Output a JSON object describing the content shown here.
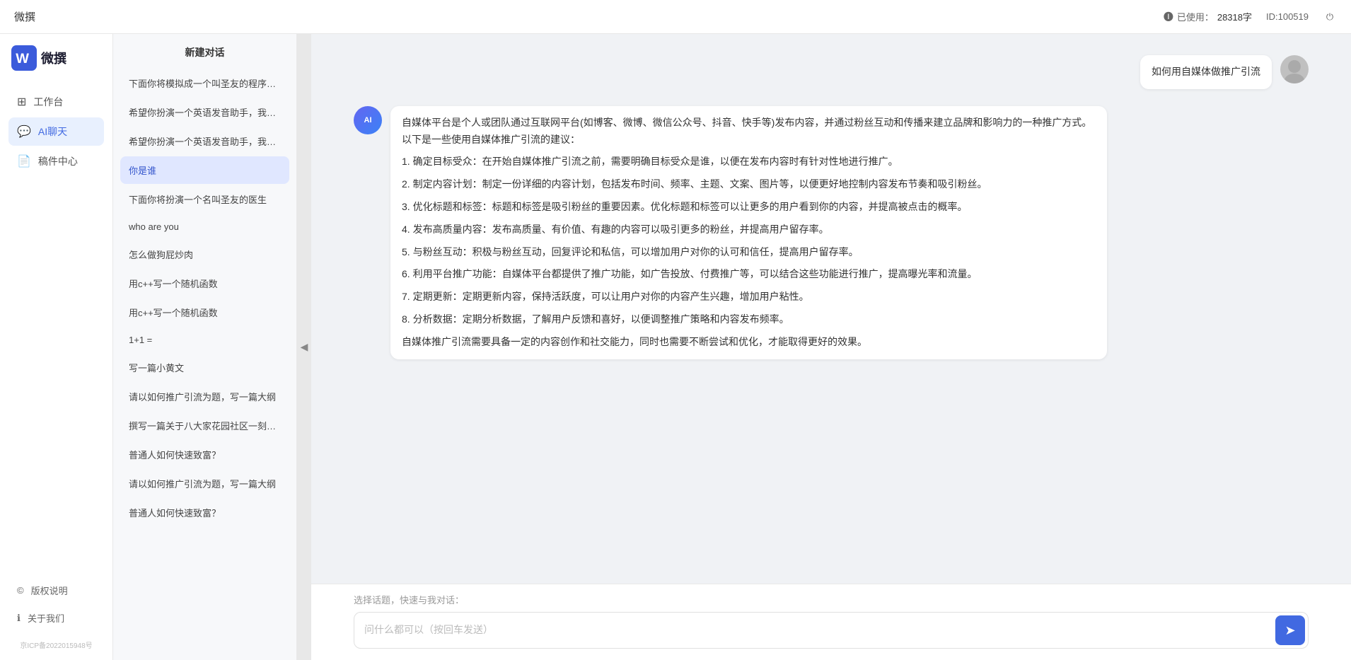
{
  "topbar": {
    "title": "微撰",
    "usage_label": "已使用：",
    "usage_value": "28318字",
    "id_label": "ID:100519",
    "power_icon": "⏻"
  },
  "sidebar": {
    "logo_text": "微撰",
    "nav_items": [
      {
        "id": "workbench",
        "label": "工作台",
        "icon": "⊞"
      },
      {
        "id": "ai-chat",
        "label": "AI聊天",
        "icon": "💬",
        "active": true
      },
      {
        "id": "drafts",
        "label": "稿件中心",
        "icon": "📄"
      }
    ],
    "bottom_items": [
      {
        "id": "copyright",
        "label": "版权说明",
        "icon": "©"
      },
      {
        "id": "about",
        "label": "关于我们",
        "icon": "ℹ"
      }
    ],
    "icp": "京ICP备2022015948号"
  },
  "chat_history": {
    "new_chat_label": "新建对话",
    "items": [
      {
        "id": "h1",
        "text": "下面你将模拟成一个叫圣友的程序员，我说...",
        "active": false
      },
      {
        "id": "h2",
        "text": "希望你扮演一个英语发音助手，我提供给你...",
        "active": false
      },
      {
        "id": "h3",
        "text": "希望你扮演一个英语发音助手，我提供给你...",
        "active": false
      },
      {
        "id": "h4",
        "text": "你是谁",
        "active": true
      },
      {
        "id": "h5",
        "text": "下面你将扮演一个名叫圣友的医生",
        "active": false
      },
      {
        "id": "h6",
        "text": "who are you",
        "active": false
      },
      {
        "id": "h7",
        "text": "怎么做狗屁炒肉",
        "active": false
      },
      {
        "id": "h8",
        "text": "用c++写一个随机函数",
        "active": false
      },
      {
        "id": "h9",
        "text": "用c++写一个随机函数",
        "active": false
      },
      {
        "id": "h10",
        "text": "1+1 =",
        "active": false
      },
      {
        "id": "h11",
        "text": "写一篇小黄文",
        "active": false
      },
      {
        "id": "h12",
        "text": "请以如何推广引流为题，写一篇大纲",
        "active": false
      },
      {
        "id": "h13",
        "text": "撰写一篇关于八大家花园社区一刻钟便民生...",
        "active": false
      },
      {
        "id": "h14",
        "text": "普通人如何快速致富？",
        "active": false
      },
      {
        "id": "h15",
        "text": "请以如何推广引流为题，写一篇大纲",
        "active": false
      },
      {
        "id": "h16",
        "text": "普通人如何快速致富？",
        "active": false
      }
    ]
  },
  "chat": {
    "user_question": "如何用自媒体做推广引流",
    "ai_response_paragraphs": [
      "自媒体平台是个人或团队通过互联网平台(如博客、微博、微信公众号、抖音、快手等)发布内容，并通过粉丝互动和传播来建立品牌和影响力的一种推广方式。以下是一些使用自媒体推广引流的建议：",
      "1. 确定目标受众：在开始自媒体推广引流之前，需要明确目标受众是谁，以便在发布内容时有针对性地进行推广。",
      "2. 制定内容计划：制定一份详细的内容计划，包括发布时间、频率、主题、文案、图片等，以便更好地控制内容发布节奏和吸引粉丝。",
      "3. 优化标题和标签：标题和标签是吸引粉丝的重要因素。优化标题和标签可以让更多的用户看到你的内容，并提高被点击的概率。",
      "4. 发布高质量内容：发布高质量、有价值、有趣的内容可以吸引更多的粉丝，并提高用户留存率。",
      "5. 与粉丝互动：积极与粉丝互动，回复评论和私信，可以增加用户对你的认可和信任，提高用户留存率。",
      "6. 利用平台推广功能：自媒体平台都提供了推广功能，如广告投放、付费推广等，可以结合这些功能进行推广，提高曝光率和流量。",
      "7. 定期更新：定期更新内容，保持活跃度，可以让用户对你的内容产生兴趣，增加用户粘性。",
      "8. 分析数据：定期分析数据，了解用户反馈和喜好，以便调整推广策略和内容发布频率。",
      "自媒体推广引流需要具备一定的内容创作和社交能力，同时也需要不断尝试和优化，才能取得更好的效果。"
    ],
    "input_placeholder": "问什么都可以（按回车发送）",
    "quick_label": "选择话题，快速与我对话："
  }
}
